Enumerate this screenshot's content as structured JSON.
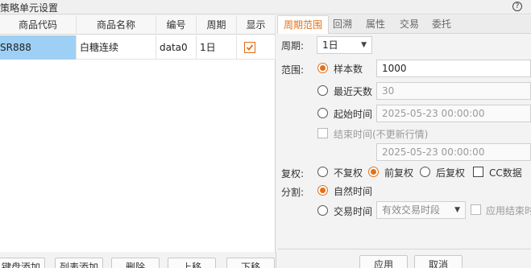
{
  "window": {
    "title": "策略单元设置",
    "help_glyph": "?"
  },
  "table": {
    "headers": [
      "商品代码",
      "商品名称",
      "编号",
      "周期",
      "显示"
    ],
    "rows": [
      {
        "code": "SR888",
        "name": "白糖连续",
        "id": "data0",
        "period": "1日",
        "show": true
      }
    ]
  },
  "left_buttons": [
    "键盘添加",
    "列表添加",
    "删除",
    "上移",
    "下移"
  ],
  "tabs": [
    "周期范围",
    "回溯",
    "属性",
    "交易",
    "委托"
  ],
  "active_tab": "周期范围",
  "period": {
    "label": "周期:",
    "value": "1日"
  },
  "range": {
    "label": "范围:",
    "sample_count": {
      "label": "样本数",
      "value": "1000",
      "selected": true
    },
    "recent_days": {
      "label": "最近天数",
      "value": "30",
      "selected": false
    },
    "start_time": {
      "label": "起始时间",
      "value": "2025-05-23 00:00:00",
      "selected": false
    },
    "end_time": {
      "label": "结束时间(不更新行情)",
      "value": "2025-05-23 00:00:00",
      "checked": false
    }
  },
  "adjust": {
    "label": "复权:",
    "options": [
      "不复权",
      "前复权",
      "后复权"
    ],
    "selected": "前复权",
    "cc_label": "CC数据",
    "cc_checked": false
  },
  "split": {
    "label": "分割:",
    "natural": {
      "label": "自然时间",
      "selected": true
    },
    "trading": {
      "label": "交易时间",
      "selected": false,
      "select_value": "有效交易时段"
    },
    "apply_end_label": "应用结束时"
  },
  "footer": {
    "ok": "应用",
    "cancel": "取消"
  },
  "colors": {
    "accent": "#e2711a",
    "selection": "#9ed0f5"
  }
}
